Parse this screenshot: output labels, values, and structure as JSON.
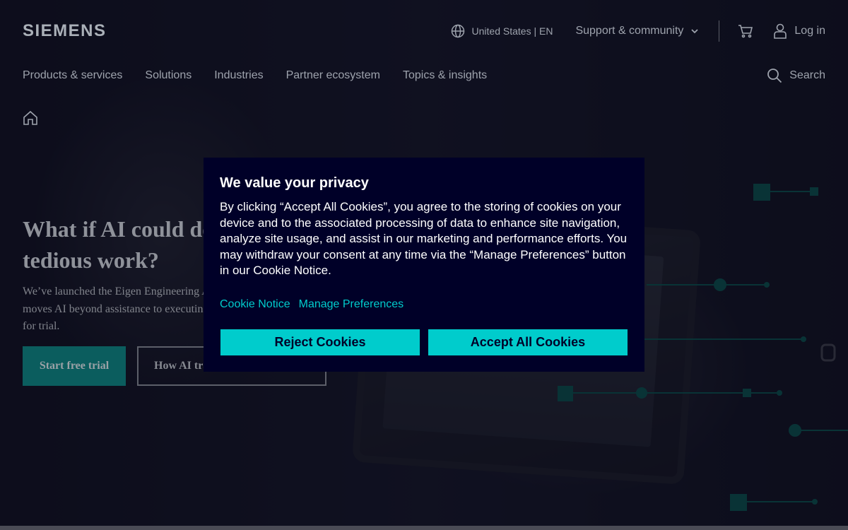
{
  "header": {
    "logo": "SIEMENS",
    "locale": "United States | EN",
    "support": "Support & community",
    "login": "Log in",
    "search": "Search"
  },
  "nav": {
    "items": [
      {
        "label": "Products & services"
      },
      {
        "label": "Solutions"
      },
      {
        "label": "Industries"
      },
      {
        "label": "Partner ecosystem"
      },
      {
        "label": "Topics & insights"
      }
    ]
  },
  "hero": {
    "title_line1": "What if AI could do the",
    "title_line2": "tedious work?",
    "description": "We’ve launched the Eigen Engineering Agent for industrial automation engineering. It moves AI beyond assistance to executing engineering tasks end-to-end. Now available for trial.",
    "primary_button": "Start free trial",
    "secondary_button": "How AI transforms engineering"
  },
  "cookie_banner": {
    "title": "We value your privacy",
    "body": "By clicking “Accept All Cookies”, you agree to the storing of cookies on your device and to the associated processing of data to enhance site navigation, analyze site usage, and assist in our marketing and performance efforts. You may withdraw your consent at any time via the “Manage Preferences” button in our Cookie Notice.",
    "link_notice": "Cookie Notice",
    "link_preferences": "Manage Preferences",
    "reject_label": "Reject Cookies",
    "accept_label": "Accept All Cookies"
  },
  "colors": {
    "accent": "#00cccc",
    "modal_bg": "#000028",
    "trial_button": "#0b5d5e"
  }
}
